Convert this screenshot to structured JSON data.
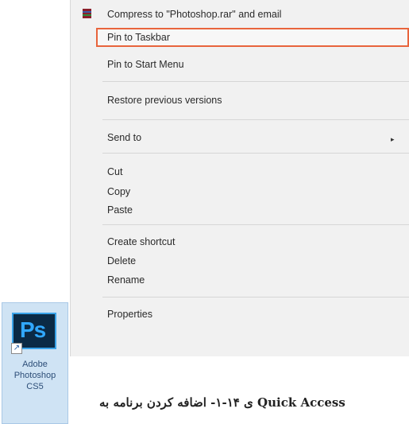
{
  "context_menu": {
    "items": [
      {
        "label": "Compress to \"Photoshop.rar\" and email"
      },
      {
        "label": "Pin to Taskbar"
      },
      {
        "label": "Pin to Start Menu"
      },
      {
        "label": "Restore previous versions"
      },
      {
        "label": "Send to"
      },
      {
        "label": "Cut"
      },
      {
        "label": "Copy"
      },
      {
        "label": "Paste"
      },
      {
        "label": "Create shortcut"
      },
      {
        "label": "Delete"
      },
      {
        "label": "Rename"
      },
      {
        "label": "Properties"
      }
    ],
    "submenu_arrow": "▸",
    "highlight_color": "#e8643c"
  },
  "desktop_icon": {
    "tile_text": "Ps",
    "label_line1": "Adobe",
    "label_line2": "Photoshop",
    "label_line3": "CS5",
    "shortcut_glyph": "↗"
  },
  "caption": {
    "text": "ی ۱۴-۱- اضافه کردن برنامه به Quick Access"
  }
}
